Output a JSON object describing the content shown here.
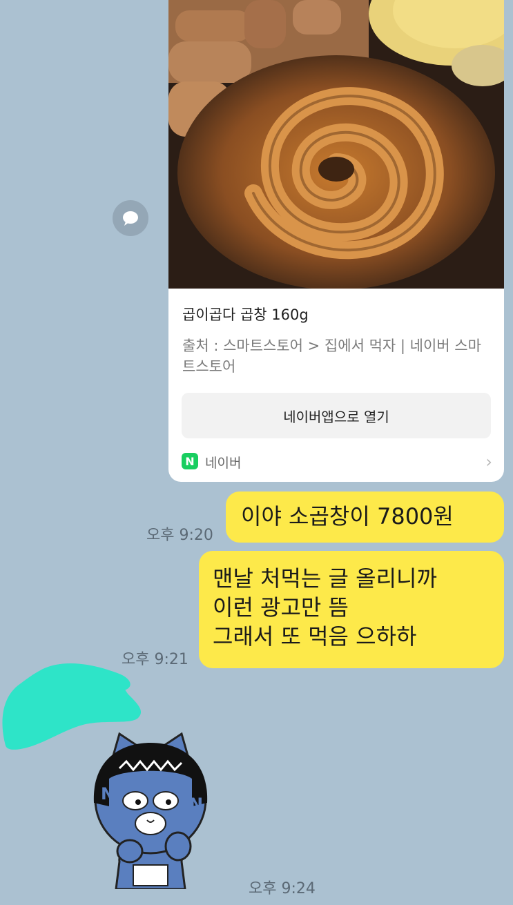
{
  "link_card": {
    "image_alt": "grilled gopchang spiral",
    "title": "곱이곱다 곱창 160g",
    "source": "출처 : 스마트스토어 > 집에서 먹자 | 네이버 스마트스토어",
    "open_button": "네이버앱으로 열기",
    "footer_label": "네이버",
    "footer_logo": "N",
    "chevron": "›"
  },
  "messages": [
    {
      "lines": [
        "이야 소곱창이 7800원"
      ],
      "time": "오후 9:20"
    },
    {
      "lines": [
        "맨날 처먹는 글 올리니까",
        "이런 광고만 뜸",
        "그래서 또 먹음  으하하"
      ],
      "time": "오후 9:21"
    }
  ],
  "sticker": {
    "letter_left": "N",
    "letter_right": "N",
    "time": "오후 9:24"
  },
  "colors": {
    "chat_background": "#abc1d1",
    "bubble": "#fde94a",
    "naver_green": "#19ce60",
    "redaction": "#2ee4c8"
  },
  "icons": {
    "share": "speech-bubble-icon",
    "chevron": "chevron-right-icon",
    "logo": "naver-logo-icon"
  }
}
